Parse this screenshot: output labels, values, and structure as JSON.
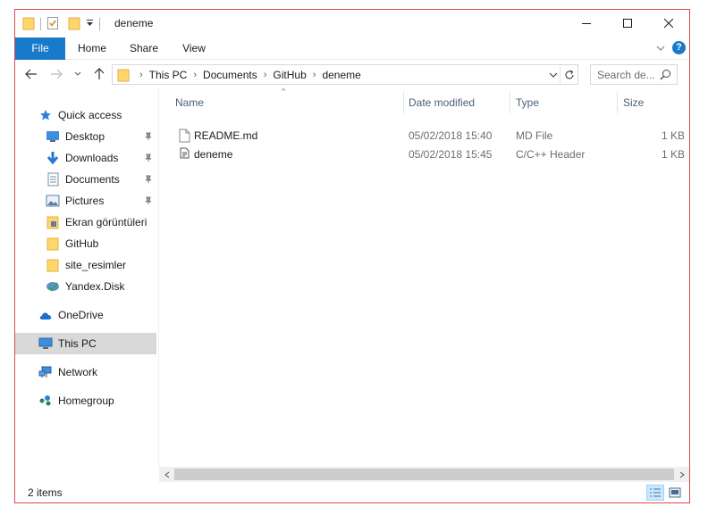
{
  "window": {
    "title": "deneme"
  },
  "ribbon": {
    "tabs": [
      "File",
      "Home",
      "Share",
      "View"
    ]
  },
  "address": {
    "crumbs": [
      "This PC",
      "Documents",
      "GitHub",
      "deneme"
    ]
  },
  "search": {
    "placeholder": "Search de..."
  },
  "nav": {
    "quick_access": "Quick access",
    "items": [
      {
        "label": "Desktop",
        "pinned": true
      },
      {
        "label": "Downloads",
        "pinned": true
      },
      {
        "label": "Documents",
        "pinned": true
      },
      {
        "label": "Pictures",
        "pinned": true
      },
      {
        "label": "Ekran görüntüleri",
        "pinned": false
      },
      {
        "label": "GitHub",
        "pinned": false
      },
      {
        "label": "site_resimler",
        "pinned": false
      },
      {
        "label": "Yandex.Disk",
        "pinned": false
      }
    ],
    "onedrive": "OneDrive",
    "thispc": "This PC",
    "network": "Network",
    "homegroup": "Homegroup"
  },
  "columns": {
    "name": "Name",
    "date": "Date modified",
    "type": "Type",
    "size": "Size"
  },
  "files": [
    {
      "name": "README.md",
      "date": "05/02/2018 15:40",
      "type": "MD File",
      "size": "1 KB"
    },
    {
      "name": "deneme",
      "date": "05/02/2018 15:45",
      "type": "C/C++ Header",
      "size": "1 KB"
    }
  ],
  "status": {
    "count": "2 items"
  },
  "colors": {
    "accent": "#1979ca",
    "frame": "#e0474c",
    "folder": "#ffd66b",
    "selected": "#d9d9d9"
  }
}
